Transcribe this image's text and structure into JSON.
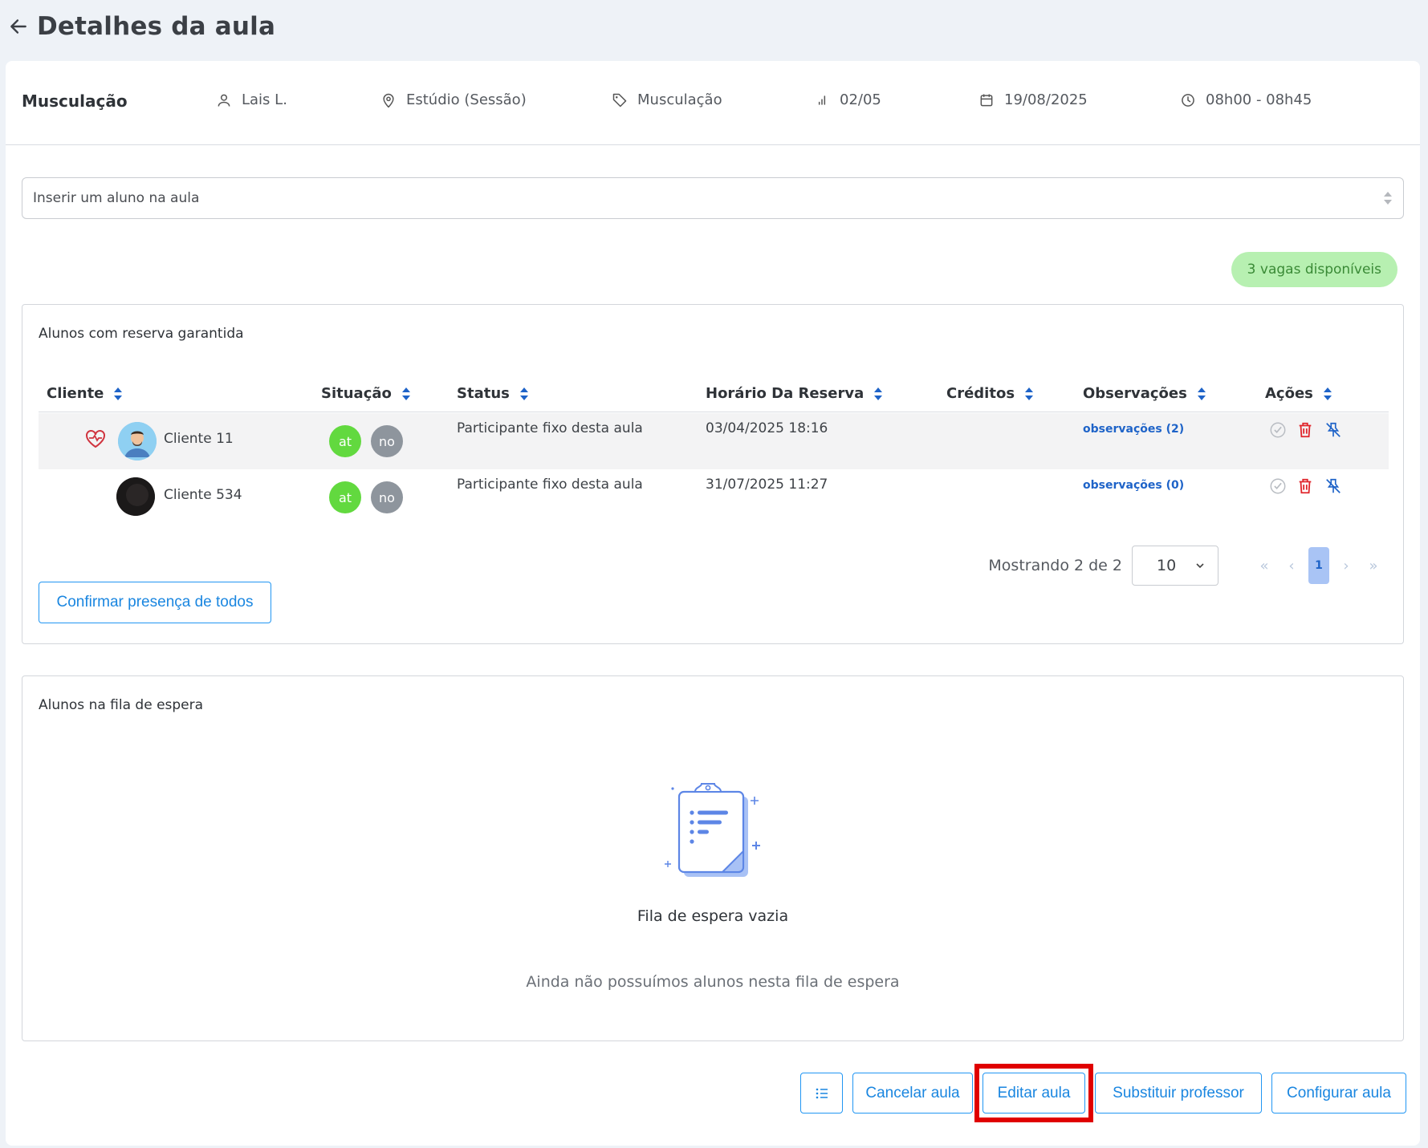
{
  "header": {
    "title": "Detalhes da aula"
  },
  "class_info": {
    "name": "Musculação",
    "teacher": "Lais L.",
    "location": "Estúdio (Sessão)",
    "modality": "Musculação",
    "occupancy": "02/05",
    "date": "19/08/2025",
    "time": "08h00 - 08h45"
  },
  "insert_student": {
    "placeholder": "Inserir um aluno na aula"
  },
  "vacancies_badge": "3 vagas disponíveis",
  "reserved": {
    "title": "Alunos com reserva garantida",
    "columns": [
      "Cliente",
      "Situação",
      "Status",
      "Horário Da Reserva",
      "Créditos",
      "Observações",
      "Ações"
    ],
    "rows": [
      {
        "client": "Cliente 11",
        "badges": [
          "at",
          "no"
        ],
        "status": "Participante fixo desta aula",
        "reservation_time": "03/04/2025 18:16",
        "credits": "",
        "observations": "observações (2)",
        "has_health_icon": true
      },
      {
        "client": "Cliente 534",
        "badges": [
          "at",
          "no"
        ],
        "status": "Participante fixo desta aula",
        "reservation_time": "31/07/2025 11:27",
        "credits": "",
        "observations": "observações (0)",
        "has_health_icon": false
      }
    ],
    "showing_text": "Mostrando 2 de 2",
    "page_size": "10",
    "current_page": "1",
    "confirm_all_label": "Confirmar presença de todos"
  },
  "waiting": {
    "title": "Alunos na fila de espera",
    "empty_title": "Fila de espera vazia",
    "empty_subtitle": "Ainda não possuímos alunos nesta fila de espera"
  },
  "footer": {
    "cancel_label": "Cancelar aula",
    "edit_label": "Editar aula",
    "substitute_label": "Substituir professor",
    "configure_label": "Configurar aula"
  },
  "colors": {
    "accent": "#2196f3",
    "badge_green": "#62d93f",
    "badge_gray": "#8e959d",
    "vacancy_bg": "#b7f0b1",
    "highlight": "#e00000"
  }
}
